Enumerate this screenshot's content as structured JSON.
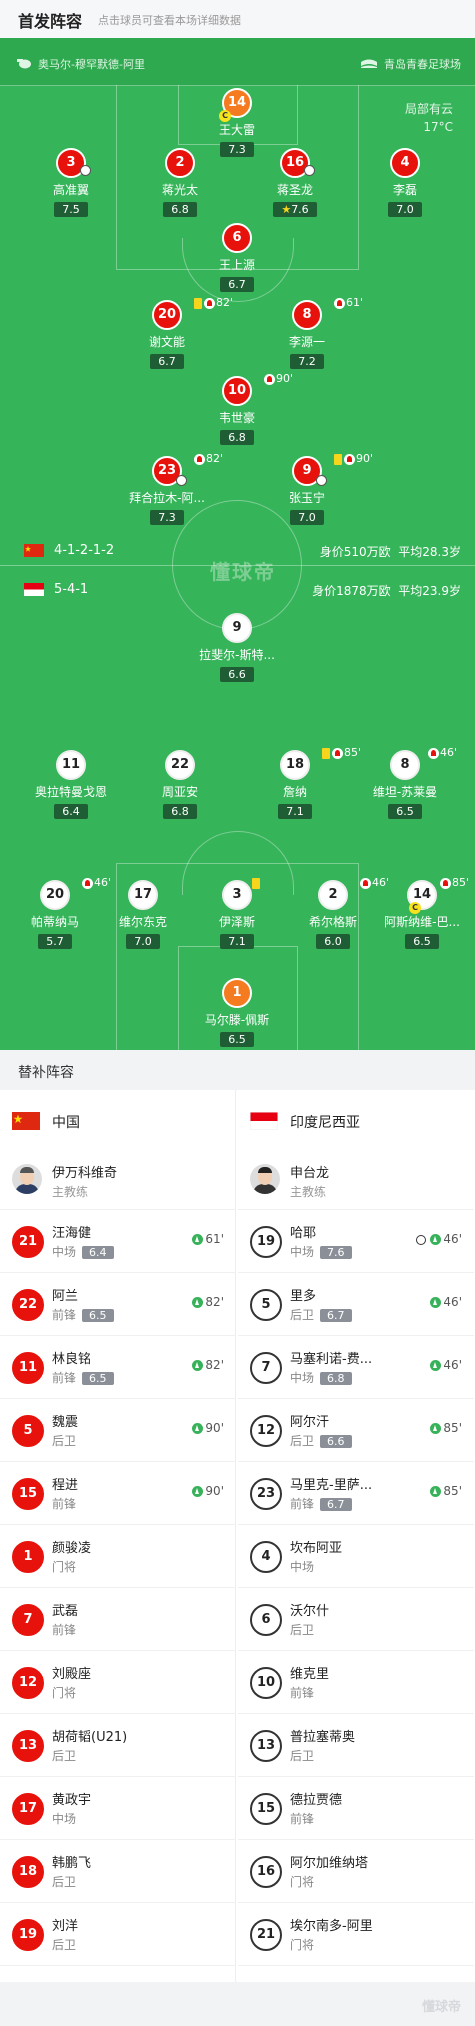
{
  "header": {
    "title": "首发阵容",
    "subtitle": "点击球员可查看本场详细数据"
  },
  "match": {
    "referee": "奥马尔-穆罕默德-阿里",
    "stadium": "青岛青春足球场",
    "weather": "局部有云",
    "temperature": "17°C",
    "watermark": "懂球帝"
  },
  "home": {
    "formation": "4-1-2-1-2",
    "value": "身价510万欧",
    "avg_age": "平均28.3岁",
    "players": [
      {
        "num": "14",
        "name": "王大雷",
        "rating": "7.3",
        "captain": "C"
      },
      {
        "num": "3",
        "name": "高准翼",
        "rating": "7.5"
      },
      {
        "num": "2",
        "name": "蒋光太",
        "rating": "6.8"
      },
      {
        "num": "16",
        "name": "蒋圣龙",
        "rating": "7.6"
      },
      {
        "num": "4",
        "name": "李磊",
        "rating": "7.0"
      },
      {
        "num": "6",
        "name": "王上源",
        "rating": "6.7"
      },
      {
        "num": "20",
        "name": "谢文能",
        "rating": "6.7",
        "sub_min": "82'"
      },
      {
        "num": "8",
        "name": "李源一",
        "rating": "7.2",
        "sub_min": "61'"
      },
      {
        "num": "10",
        "name": "韦世豪",
        "rating": "6.8",
        "sub_min": "90'"
      },
      {
        "num": "23",
        "name": "拜合拉木-阿...",
        "rating": "7.3",
        "sub_min": "82'"
      },
      {
        "num": "9",
        "name": "张玉宁",
        "rating": "7.0",
        "sub_min": "90'"
      }
    ]
  },
  "away": {
    "formation": "5-4-1",
    "value": "身价1878万欧",
    "avg_age": "平均23.9岁",
    "players": [
      {
        "num": "9",
        "name": "拉斐尔-斯特...",
        "rating": "6.6"
      },
      {
        "num": "11",
        "name": "奥拉特曼戈恩",
        "rating": "6.4"
      },
      {
        "num": "22",
        "name": "周亚安",
        "rating": "6.8"
      },
      {
        "num": "18",
        "name": "詹纳",
        "rating": "7.1",
        "sub_min": "85'"
      },
      {
        "num": "8",
        "name": "维坦-苏莱曼",
        "rating": "6.5",
        "sub_min": "46'"
      },
      {
        "num": "20",
        "name": "帕蒂纳马",
        "rating": "5.7",
        "sub_min": "46'"
      },
      {
        "num": "17",
        "name": "维尔东克",
        "rating": "7.0"
      },
      {
        "num": "3",
        "name": "伊泽斯",
        "rating": "7.1"
      },
      {
        "num": "2",
        "name": "希尔格斯",
        "rating": "6.0",
        "sub_min": "46'"
      },
      {
        "num": "14",
        "name": "阿斯纳维-巴...",
        "rating": "6.5",
        "sub_min": "85'",
        "captain": "C"
      },
      {
        "num": "1",
        "name": "马尔滕-佩斯",
        "rating": "6.5"
      }
    ]
  },
  "subs": {
    "title": "替补阵容",
    "home": {
      "team": "中国",
      "coach": {
        "name": "伊万科维奇",
        "role": "主教练"
      },
      "players": [
        {
          "num": "21",
          "name": "汪海健",
          "pos": "中场",
          "rating": "6.4",
          "min": "61'"
        },
        {
          "num": "22",
          "name": "阿兰",
          "pos": "前锋",
          "rating": "6.5",
          "min": "82'"
        },
        {
          "num": "11",
          "name": "林良铭",
          "pos": "前锋",
          "rating": "6.5",
          "min": "82'"
        },
        {
          "num": "5",
          "name": "魏震",
          "pos": "后卫",
          "rating": "",
          "min": "90'"
        },
        {
          "num": "15",
          "name": "程进",
          "pos": "前锋",
          "rating": "",
          "min": "90'"
        },
        {
          "num": "1",
          "name": "颜骏凌",
          "pos": "门将",
          "rating": "",
          "min": ""
        },
        {
          "num": "7",
          "name": "武磊",
          "pos": "前锋",
          "rating": "",
          "min": ""
        },
        {
          "num": "12",
          "name": "刘殿座",
          "pos": "门将",
          "rating": "",
          "min": ""
        },
        {
          "num": "13",
          "name": "胡荷韬(U21)",
          "pos": "后卫",
          "rating": "",
          "min": ""
        },
        {
          "num": "17",
          "name": "黄政宇",
          "pos": "中场",
          "rating": "",
          "min": ""
        },
        {
          "num": "18",
          "name": "韩鹏飞",
          "pos": "后卫",
          "rating": "",
          "min": ""
        },
        {
          "num": "19",
          "name": "刘洋",
          "pos": "后卫",
          "rating": "",
          "min": ""
        }
      ]
    },
    "away": {
      "team": "印度尼西亚",
      "coach": {
        "name": "申台龙",
        "role": "主教练"
      },
      "players": [
        {
          "num": "19",
          "name": "哈耶",
          "pos": "中场",
          "rating": "7.6",
          "min": "46'",
          "goal": true
        },
        {
          "num": "5",
          "name": "里多",
          "pos": "后卫",
          "rating": "6.7",
          "min": "46'"
        },
        {
          "num": "7",
          "name": "马塞利诺-费...",
          "pos": "中场",
          "rating": "6.8",
          "min": "46'"
        },
        {
          "num": "12",
          "name": "阿尔汗",
          "pos": "后卫",
          "rating": "6.6",
          "min": "85'"
        },
        {
          "num": "23",
          "name": "马里克-里萨...",
          "pos": "前锋",
          "rating": "6.7",
          "min": "85'"
        },
        {
          "num": "4",
          "name": "坎布阿亚",
          "pos": "中场",
          "rating": "",
          "min": ""
        },
        {
          "num": "6",
          "name": "沃尔什",
          "pos": "后卫",
          "rating": "",
          "min": ""
        },
        {
          "num": "10",
          "name": "维克里",
          "pos": "前锋",
          "rating": "",
          "min": ""
        },
        {
          "num": "13",
          "name": "普拉塞蒂奥",
          "pos": "后卫",
          "rating": "",
          "min": ""
        },
        {
          "num": "15",
          "name": "德拉贾德",
          "pos": "前锋",
          "rating": "",
          "min": ""
        },
        {
          "num": "16",
          "name": "阿尔加维纳塔",
          "pos": "门将",
          "rating": "",
          "min": ""
        },
        {
          "num": "21",
          "name": "埃尔南多-阿里",
          "pos": "门将",
          "rating": "",
          "min": ""
        }
      ]
    }
  },
  "footer": {
    "watermark": "懂球帝"
  },
  "colors": {
    "pitch": "#36b45a",
    "home": "#e8120c",
    "captain": "#f47b20",
    "rating_bg": "#1f5e34"
  }
}
